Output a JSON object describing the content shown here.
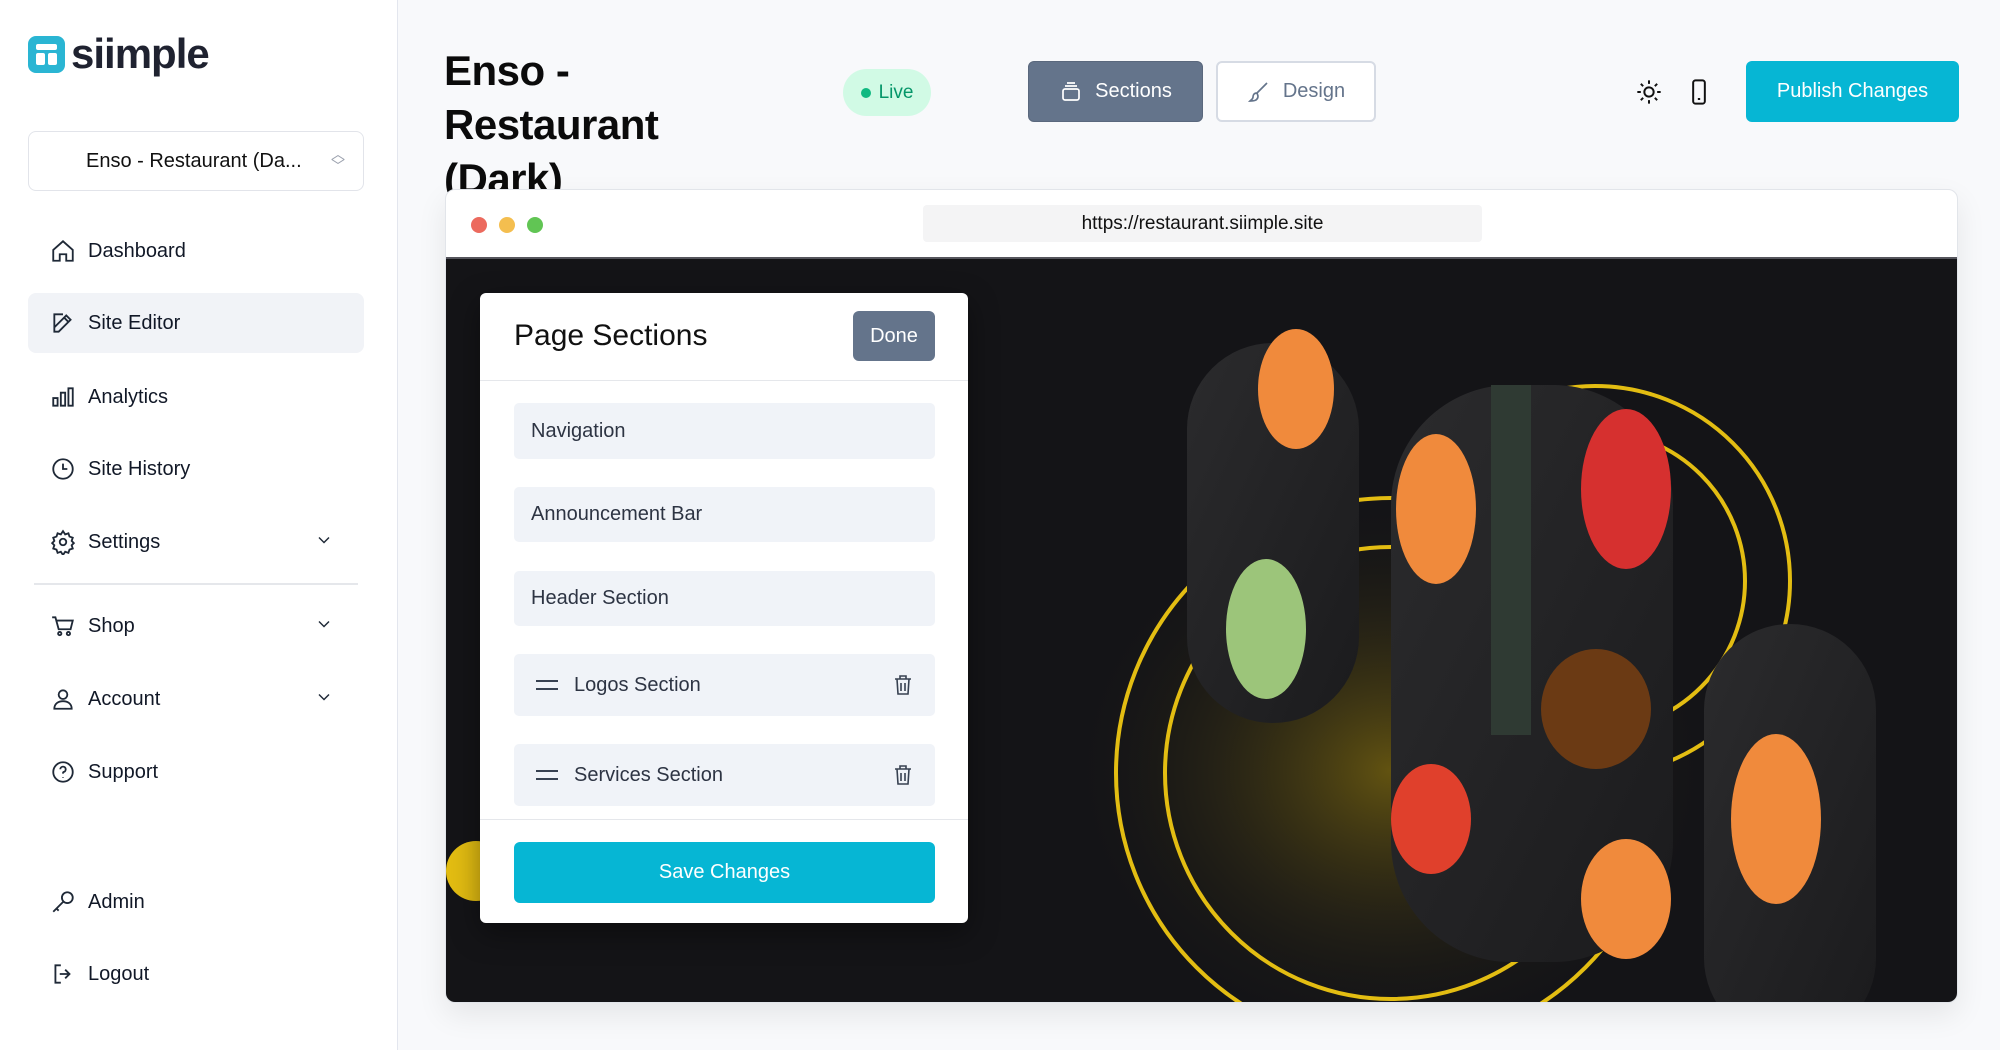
{
  "brand": {
    "name": "siimple",
    "color": "#2ab5d3"
  },
  "sidebar": {
    "site_select": "Enso - Restaurant (Da...",
    "items": [
      {
        "label": "Dashboard",
        "icon": "home-icon"
      },
      {
        "label": "Site Editor",
        "icon": "edit-icon",
        "active": true
      },
      {
        "label": "Analytics",
        "icon": "bar-chart-icon"
      },
      {
        "label": "Site History",
        "icon": "clock-icon"
      },
      {
        "label": "Settings",
        "icon": "gear-icon",
        "expandable": true
      },
      {
        "label": "Shop",
        "icon": "cart-icon",
        "expandable": true
      },
      {
        "label": "Account",
        "icon": "user-icon",
        "expandable": true
      },
      {
        "label": "Support",
        "icon": "help-icon"
      },
      {
        "label": "Admin",
        "icon": "key-icon"
      },
      {
        "label": "Logout",
        "icon": "logout-icon"
      }
    ]
  },
  "header": {
    "title": "Enso - Restaurant (Dark)",
    "status": "Live",
    "sections_label": "Sections",
    "design_label": "Design",
    "publish_label": "Publish Changes",
    "accent": "#06b6d4"
  },
  "browser": {
    "url": "https://restaurant.siimple.site"
  },
  "popup": {
    "title": "Page Sections",
    "done_label": "Done",
    "sections": [
      {
        "label": "Navigation",
        "removable": false
      },
      {
        "label": "Announcement Bar",
        "removable": false
      },
      {
        "label": "Header Section",
        "removable": false
      },
      {
        "label": "Logos Section",
        "removable": true
      },
      {
        "label": "Services Section",
        "removable": true
      }
    ],
    "save_label": "Save Changes"
  }
}
